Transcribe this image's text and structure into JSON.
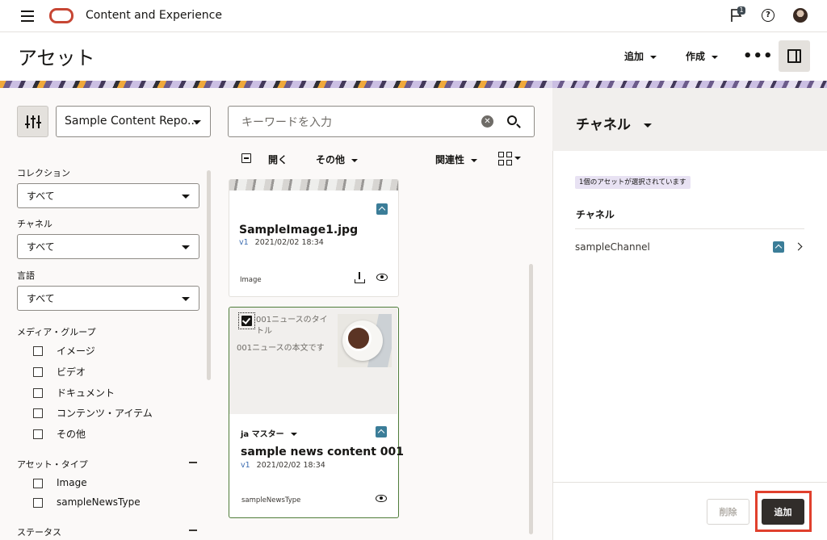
{
  "header": {
    "app_title": "Content and Experience",
    "notification_count": "1",
    "help_symbol": "?"
  },
  "page": {
    "title": "アセット",
    "add_label": "追加",
    "create_label": "作成",
    "more_label": "•••"
  },
  "filters": {
    "repository": "Sample Content Repo...",
    "collection_label": "コレクション",
    "collection_value": "すべて",
    "channel_label": "チャネル",
    "channel_value": "すべて",
    "language_label": "言語",
    "language_value": "すべて",
    "media_group_label": "メディア・グループ",
    "media_groups": [
      "イメージ",
      "ビデオ",
      "ドキュメント",
      "コンテンツ・アイテム",
      "その他"
    ],
    "asset_type_label": "アセット・タイプ",
    "asset_types": [
      "Image",
      "sampleNewsType"
    ],
    "status_label": "ステータス"
  },
  "search": {
    "placeholder": "キーワードを入力",
    "clear_symbol": "✕"
  },
  "toolbar": {
    "open_label": "開く",
    "other_label": "その他",
    "sort_label": "関連性"
  },
  "cards": [
    {
      "title": "SampleImage1.jpg",
      "version": "v1",
      "date": "2021/02/02 18:34",
      "type": "Image"
    },
    {
      "title": "sample news content 001",
      "version": "v1",
      "date": "2021/02/02 18:34",
      "type": "sampleNewsType",
      "preview_title": "001ニュースのタイトル",
      "preview_body": "001ニュースの本文です",
      "language": "ja マスター"
    }
  ],
  "right_panel": {
    "title": "チャネル",
    "selected_badge": "1個のアセットが選択されています",
    "section_label": "チャネル",
    "channels": [
      "sampleChannel"
    ],
    "delete_label": "削除",
    "add_label": "追加"
  },
  "colors": {
    "accent_oracle": "#c74634",
    "selection_green": "#4f7d3a",
    "highlight_red": "#e0402d",
    "badge_purple": "#e8e2f3"
  }
}
